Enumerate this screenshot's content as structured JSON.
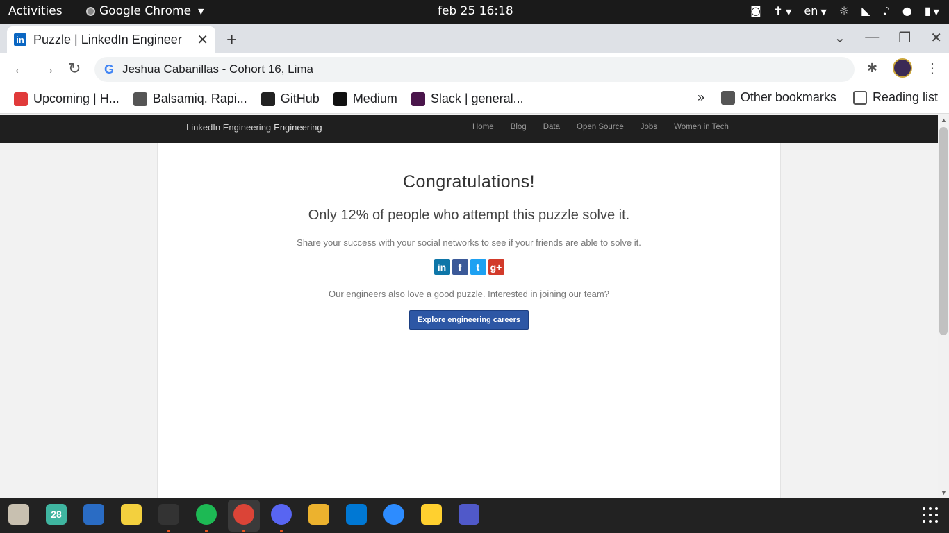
{
  "system_bar": {
    "activities": "Activities",
    "app_name": "Google Chrome",
    "clock": "feb 25  16:18",
    "language": "en"
  },
  "browser": {
    "tab_title": "Puzzle | LinkedIn Engineer",
    "omnibox_text": "Jeshua Cabanillas - Cohort 16, Lima",
    "bookmarks": [
      {
        "label": "Upcoming | H...",
        "icon": "seahorse-icon",
        "color": "#e03a3a"
      },
      {
        "label": "Balsamiq. Rapi...",
        "icon": "smiley-icon",
        "color": "#555555"
      },
      {
        "label": "GitHub",
        "icon": "github-icon",
        "color": "#222222"
      },
      {
        "label": "Medium",
        "icon": "medium-icon",
        "color": "#111111"
      },
      {
        "label": "Slack | general...",
        "icon": "slack-icon",
        "color": "#4a154b"
      }
    ],
    "more_bookmarks": "»",
    "other_bookmarks": "Other bookmarks",
    "reading_list": "Reading list"
  },
  "site": {
    "logo_alt": "LinkedIn Engineering",
    "logo_suffix": "Engineering",
    "nav": [
      "Home",
      "Blog",
      "Data",
      "Open Source",
      "Jobs",
      "Women in Tech"
    ]
  },
  "main": {
    "heading": "Congratulations!",
    "stat": "Only 12% of people who attempt this puzzle solve it.",
    "share_text": "Share your success with your social networks to see if your friends are able to solve it.",
    "social": [
      {
        "glyph": "in",
        "icon": "linkedin-icon",
        "color": "#0e76a8"
      },
      {
        "glyph": "f",
        "icon": "facebook-icon",
        "color": "#3b5998"
      },
      {
        "glyph": "t",
        "icon": "twitter-icon",
        "color": "#1da1f2"
      },
      {
        "glyph": "g+",
        "icon": "google-plus-icon",
        "color": "#d23a2a"
      }
    ],
    "join_text": "Our engineers also love a good puzzle. Interested in joining our team?",
    "cta_label": "Explore engineering careers"
  },
  "dock": {
    "calendar_day": "28",
    "apps": [
      "files-icon",
      "calendar-icon",
      "writer-icon",
      "notes-icon",
      "terminal-icon",
      "spotify-icon",
      "chrome-icon",
      "discord-icon",
      "slack-icon",
      "vscode-icon",
      "zoom-icon",
      "miro-icon",
      "teams-icon"
    ]
  }
}
